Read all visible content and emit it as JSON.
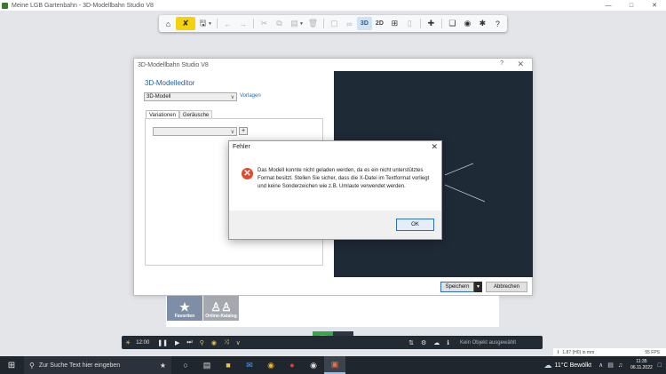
{
  "window": {
    "title": "Meine LGB Gartenbahn - 3D-Modellbahn Studio V8",
    "controls": [
      "—",
      "□",
      "✕"
    ]
  },
  "toolbar": {
    "view_3d": "3D",
    "view_2d": "2D",
    "help": "?"
  },
  "editor": {
    "title": "3D-Modellbahn Studio V8",
    "help": "?",
    "close": "✕",
    "heading": "3D-Modelleditor",
    "model_select": "3D-Modell",
    "vorlagen_link": "Vorlagen",
    "tabs": [
      "Variationen",
      "Geräusche"
    ],
    "variation_select": "",
    "add_label": "+",
    "save_label": "Speichern",
    "cancel_label": "Abbrechen"
  },
  "error": {
    "title": "Fehler",
    "close": "✕",
    "message": "Das Modell konnte nicht geladen werden, da es ein nicht unterstütztes Format besitzt. Stellen Sie sicher, dass die X-Datei im Textformat vorliegt und keine Sonderzeichen wie z.B. Umlaute verwendet werden.",
    "ok_label": "OK"
  },
  "catalog": {
    "favorites": "Favoriten",
    "online": "Online-Katalog"
  },
  "bottombar": {
    "time": "12:00",
    "status": "Kein Objekt ausgewählt"
  },
  "infobar": {
    "coords": "1.87 (H0) in mm",
    "fps": "55 FPS"
  },
  "taskbar": {
    "search_placeholder": "Zur Suche Text hier eingeben",
    "weather": "11°C  Bewölkt",
    "time": "11:35",
    "date": "06.11.2022"
  }
}
